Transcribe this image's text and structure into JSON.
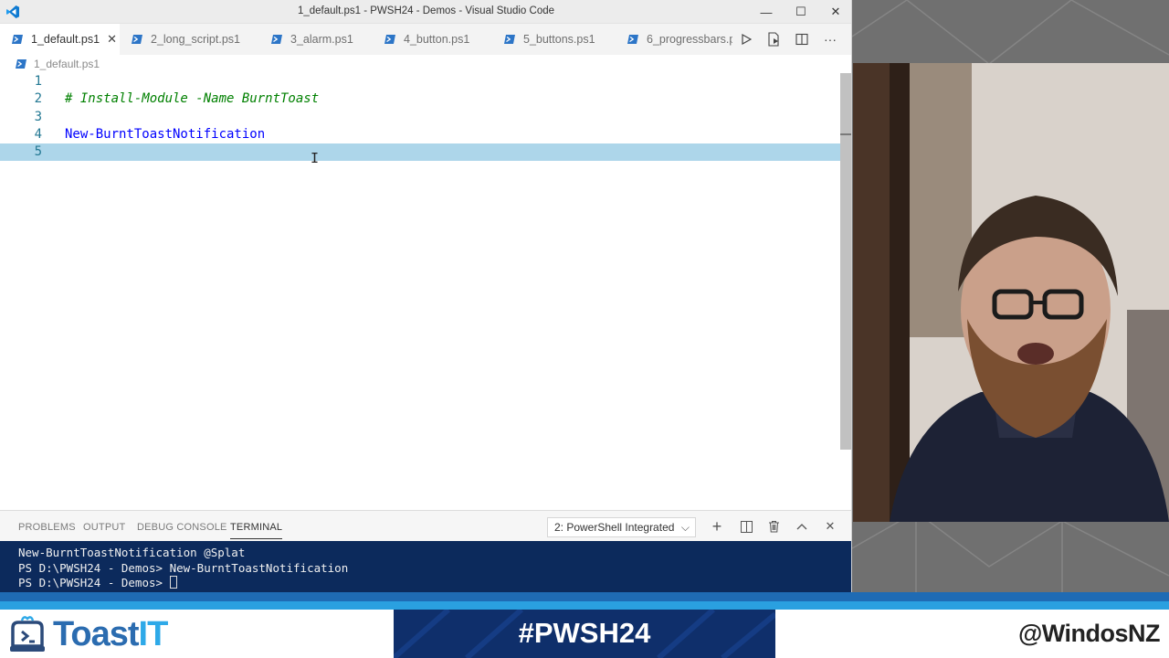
{
  "window": {
    "title": "1_default.ps1 - PWSH24 - Demos - Visual Studio Code",
    "minimize": "—",
    "maximize": "☐",
    "close": "✕"
  },
  "tabs": [
    {
      "label": "1_default.ps1",
      "active": true
    },
    {
      "label": "2_long_script.ps1"
    },
    {
      "label": "3_alarm.ps1"
    },
    {
      "label": "4_button.ps1"
    },
    {
      "label": "5_buttons.ps1"
    },
    {
      "label": "6_progressbars.p"
    }
  ],
  "breadcrumb": {
    "file": "1_default.ps1"
  },
  "editor": {
    "lines": [
      {
        "num": "1",
        "text": ""
      },
      {
        "num": "2",
        "text": "# Install-Module -Name BurntToast"
      },
      {
        "num": "3",
        "text": ""
      },
      {
        "num": "4",
        "text": "New-BurntToastNotification"
      },
      {
        "num": "5",
        "text": ""
      }
    ]
  },
  "panel": {
    "tabs": [
      "PROBLEMS",
      "OUTPUT",
      "DEBUG CONSOLE",
      "TERMINAL"
    ],
    "active_tab": "TERMINAL",
    "terminal_select": "2: PowerShell Integrated",
    "terminal_lines": [
      "New-BurntToastNotification @Splat",
      "PS D:\\PWSH24 - Demos> New-BurntToastNotification",
      "PS D:\\PWSH24 - Demos> "
    ]
  },
  "overlay": {
    "brand_main": "Toast",
    "brand_accent": "IT",
    "hashtag": "#PWSH24",
    "handle": "@WindosNZ"
  },
  "colors": {
    "accent": "#007acc",
    "terminal_bg": "#0c2a5c",
    "current_line": "#add6ea",
    "brand_blue": "#2b6cb0",
    "banner": "#0f2f6b"
  }
}
